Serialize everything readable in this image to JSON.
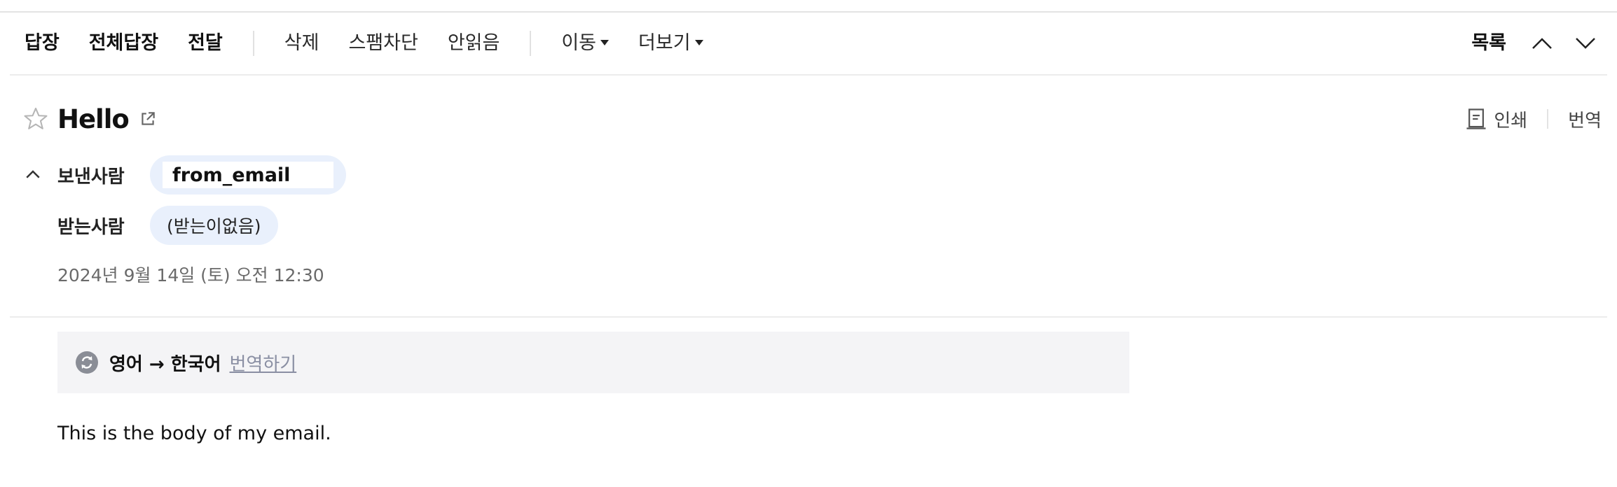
{
  "toolbar": {
    "reply": "답장",
    "reply_all": "전체답장",
    "forward": "전달",
    "delete": "삭제",
    "block_spam": "스팸차단",
    "mark_unread": "안읽음",
    "move": "이동",
    "more": "더보기",
    "list": "목록",
    "prev_icon": "chevron-up-icon",
    "next_icon": "chevron-down-icon"
  },
  "message": {
    "subject": "Hello",
    "star_icon": "star-outline-icon",
    "popout_icon": "external-link-icon",
    "print_label": "인쇄",
    "print_icon": "printer-icon",
    "translate_label": "번역",
    "sender_label": "보낸사람",
    "sender_value": "from_email",
    "recipient_label": "받는사람",
    "recipient_value": "(받는이없음)",
    "date": "2024년 9월 14일 (토) 오전 12:30",
    "body": "This is the body of my email."
  },
  "translation": {
    "icon": "refresh-icon",
    "languages": "영어 → 한국어",
    "action": "번역하기"
  },
  "colors": {
    "chip_background": "#e9f0fc",
    "translate_bar_background": "#f4f4f6",
    "link_gray": "#8a8fa3",
    "divider": "#ececec"
  }
}
